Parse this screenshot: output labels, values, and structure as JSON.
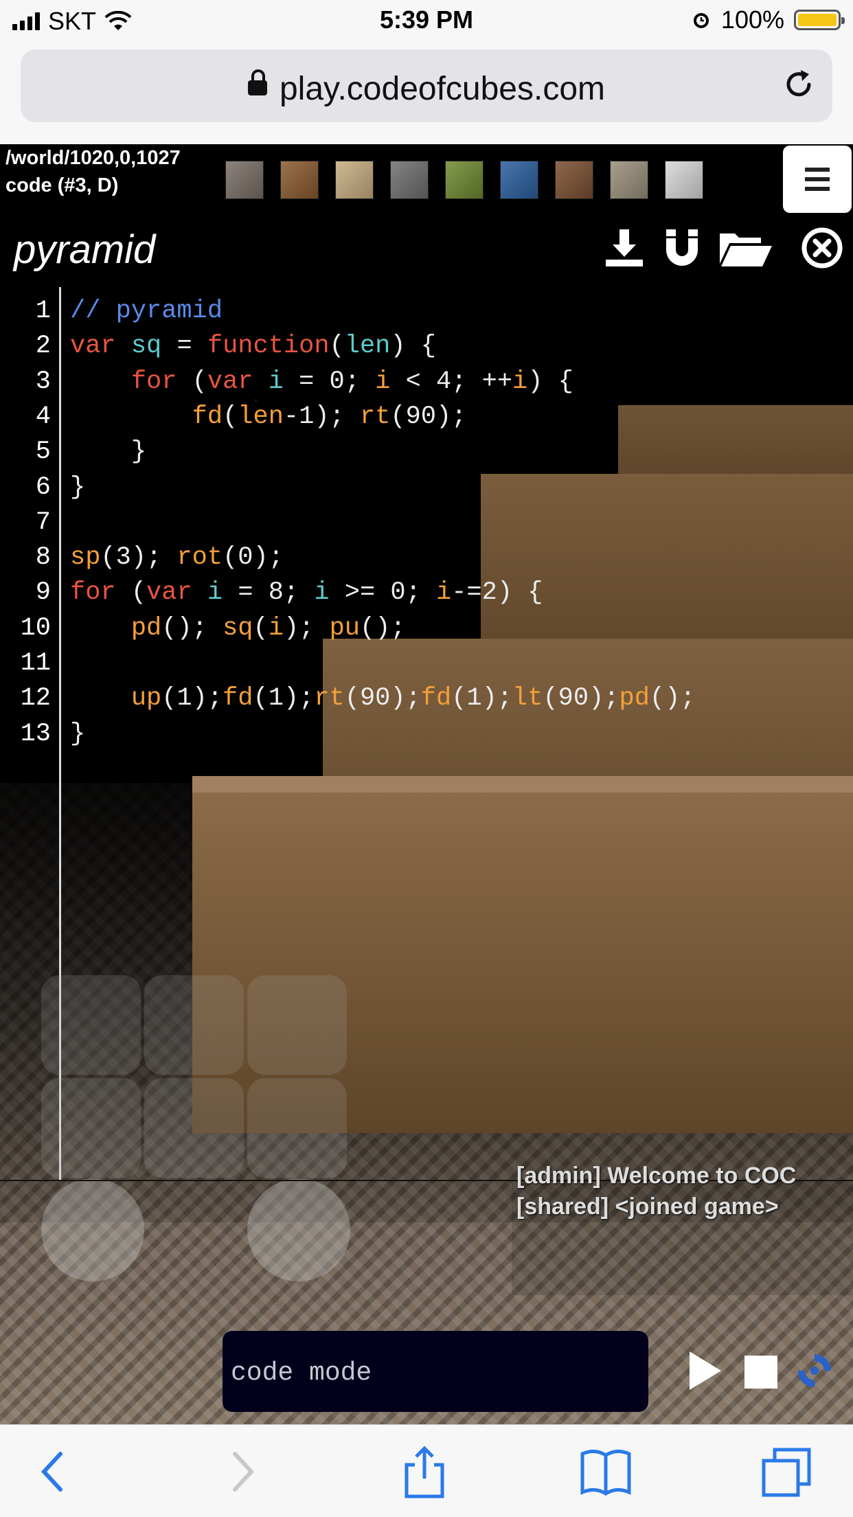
{
  "status_bar": {
    "carrier": "SKT",
    "time": "5:39 PM",
    "battery": "100%",
    "icons": [
      "signal-icon",
      "wifi-icon",
      "alarm-icon",
      "battery-icon"
    ]
  },
  "browser": {
    "url": "play.codeofcubes.com",
    "icons": [
      "lock-icon",
      "reload-icon"
    ]
  },
  "game": {
    "world_path": "/world/1020,0,1027",
    "code_info": "code (#3, D)",
    "palette": [
      "#7a6e66",
      "#8a5a2e",
      "#c8ae82",
      "#6f6f6f",
      "#6e8a30",
      "#2a5fa0",
      "#7a4e30",
      "#9a8f7a",
      "#d8d8d8"
    ],
    "menu_icon": "hamburger-menu-icon"
  },
  "editor": {
    "title": "pyramid",
    "toolbar_icons": [
      "download-icon",
      "magnet-icon",
      "folder-open-icon",
      "close-circle-icon"
    ],
    "lines": [
      {
        "n": "1",
        "tokens": [
          [
            "cm",
            "// pyramid"
          ]
        ]
      },
      {
        "n": "2",
        "tokens": [
          [
            "kw",
            "var"
          ],
          [
            "pl",
            " "
          ],
          [
            "var",
            "sq"
          ],
          [
            "pl",
            " = "
          ],
          [
            "kw",
            "function"
          ],
          [
            "pl",
            "("
          ],
          [
            "var",
            "len"
          ],
          [
            "pl",
            ") {"
          ]
        ]
      },
      {
        "n": "3",
        "tokens": [
          [
            "pl",
            "    "
          ],
          [
            "kw",
            "for"
          ],
          [
            "pl",
            " ("
          ],
          [
            "kw",
            "var"
          ],
          [
            "pl",
            " "
          ],
          [
            "var",
            "i"
          ],
          [
            "pl",
            " = 0; "
          ],
          [
            "fn",
            "i"
          ],
          [
            "pl",
            " < 4; ++"
          ],
          [
            "fn",
            "i"
          ],
          [
            "pl",
            ") {"
          ]
        ]
      },
      {
        "n": "4",
        "tokens": [
          [
            "pl",
            "        "
          ],
          [
            "fn",
            "fd"
          ],
          [
            "pl",
            "("
          ],
          [
            "fn",
            "len"
          ],
          [
            "pl",
            "-1); "
          ],
          [
            "fn",
            "rt"
          ],
          [
            "pl",
            "(90);"
          ]
        ]
      },
      {
        "n": "5",
        "tokens": [
          [
            "pl",
            "    }"
          ]
        ]
      },
      {
        "n": "6",
        "tokens": [
          [
            "pl",
            "}"
          ]
        ]
      },
      {
        "n": "7",
        "tokens": []
      },
      {
        "n": "8",
        "tokens": [
          [
            "fn",
            "sp"
          ],
          [
            "pl",
            "(3); "
          ],
          [
            "fn",
            "rot"
          ],
          [
            "pl",
            "(0);"
          ]
        ]
      },
      {
        "n": "9",
        "tokens": [
          [
            "kw",
            "for"
          ],
          [
            "pl",
            " ("
          ],
          [
            "kw",
            "var"
          ],
          [
            "pl",
            " "
          ],
          [
            "var",
            "i"
          ],
          [
            "pl",
            " = 8; "
          ],
          [
            "var",
            "i"
          ],
          [
            "pl",
            " >= 0; "
          ],
          [
            "fn",
            "i"
          ],
          [
            "pl",
            "-=2) {"
          ]
        ]
      },
      {
        "n": "10",
        "tokens": [
          [
            "pl",
            "    "
          ],
          [
            "fn",
            "pd"
          ],
          [
            "pl",
            "(); "
          ],
          [
            "fn",
            "sq"
          ],
          [
            "pl",
            "("
          ],
          [
            "fn",
            "i"
          ],
          [
            "pl",
            "); "
          ],
          [
            "fn",
            "pu"
          ],
          [
            "pl",
            "();"
          ]
        ]
      },
      {
        "n": "11",
        "tokens": []
      },
      {
        "n": "12",
        "tokens": [
          [
            "pl",
            "    "
          ],
          [
            "fn",
            "up"
          ],
          [
            "pl",
            "(1);"
          ],
          [
            "fn",
            "fd"
          ],
          [
            "pl",
            "(1);"
          ],
          [
            "fn",
            "rt"
          ],
          [
            "pl",
            "(90);"
          ],
          [
            "fn",
            "fd"
          ],
          [
            "pl",
            "(1);"
          ],
          [
            "fn",
            "lt"
          ],
          [
            "pl",
            "(90);"
          ],
          [
            "fn",
            "pd"
          ],
          [
            "pl",
            "();"
          ]
        ]
      },
      {
        "n": "13",
        "tokens": [
          [
            "pl",
            "}"
          ]
        ]
      }
    ]
  },
  "chat": {
    "messages": [
      "[admin] Welcome to COC",
      "[shared] <joined game>"
    ]
  },
  "command": {
    "placeholder": "code mode",
    "icons": [
      "play-icon",
      "stop-icon",
      "spinner-icon"
    ]
  },
  "safari_toolbar": {
    "icons": [
      "back-icon",
      "forward-icon",
      "share-icon",
      "bookmarks-icon",
      "tabs-icon"
    ]
  }
}
